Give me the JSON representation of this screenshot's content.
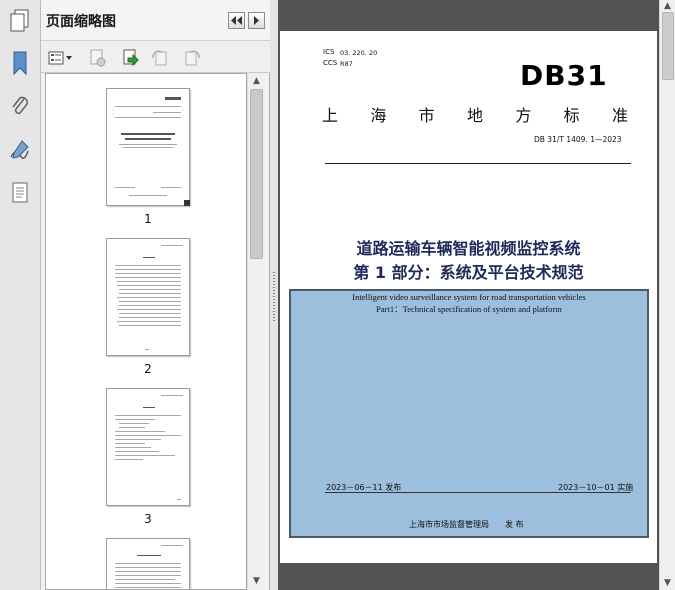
{
  "panel": {
    "title": "页面缩略图",
    "thumbnails": [
      {
        "page_number": "1"
      },
      {
        "page_number": "2"
      },
      {
        "page_number": "3"
      },
      {
        "page_number": ""
      }
    ]
  },
  "document": {
    "ics_label": "ICS",
    "ics_value": "03. 220. 20",
    "ccs_label": "CCS",
    "ccs_value": "R87",
    "logo": "DB31",
    "standard_type": [
      "上",
      "海",
      "市",
      "地",
      "方",
      "标",
      "准"
    ],
    "standard_number": "DB 31/T 1409. 1—2023",
    "title_cn_line1": "道路运输车辆智能视频监控系统",
    "title_cn_line2": "第 1 部分：系统及平台技术规范",
    "title_en_line1": "Intelligent video surveillance system for road transportation vehicles",
    "title_en_line2": "Part1：Technical specification of system and platform",
    "issue_date": "2023－06－11 发布",
    "implement_date": "2023－10－01 实施",
    "publisher": "上海市市场监督管理局　　发 布"
  },
  "colors": {
    "page_background": "#525252",
    "highlight_box": "#9bbfdc",
    "title_color": "#1f2a5a"
  }
}
